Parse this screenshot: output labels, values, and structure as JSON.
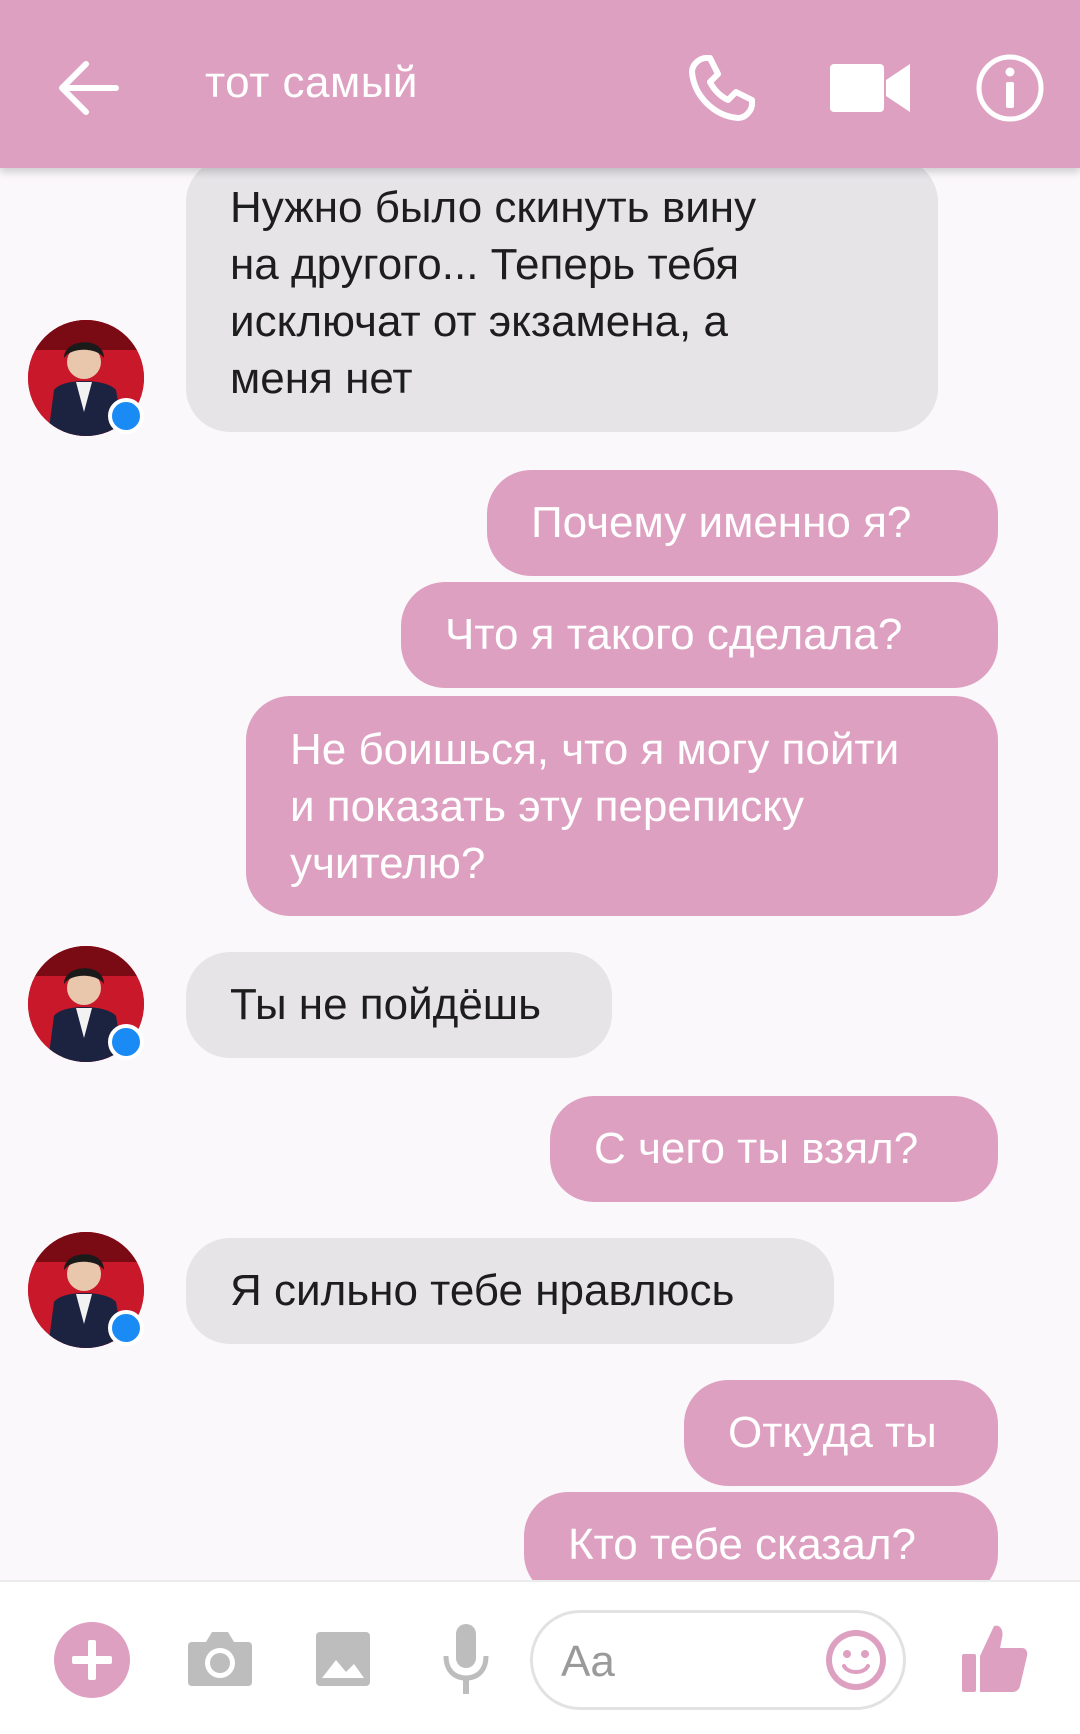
{
  "header": {
    "title": "тот самый",
    "back_icon": "arrow-left-icon",
    "call_icon": "phone-icon",
    "video_icon": "video-camera-icon",
    "info_icon": "info-icon",
    "background_color": "#dea0c1"
  },
  "messages": [
    {
      "from": "contact",
      "text": "Нужно было скинуть вину\nна другого...  Теперь тебя\nисключат от экзамена, а\nменя нет"
    },
    {
      "from": "me",
      "text": "Почему именно я?"
    },
    {
      "from": "me",
      "text": "Что я такого сделала?"
    },
    {
      "from": "me",
      "text": "Не боишься, что я могу пойти\nи показать эту переписку\nучителю?"
    },
    {
      "from": "contact",
      "text": "Ты не пойдёшь"
    },
    {
      "from": "me",
      "text": "С чего ты взял?"
    },
    {
      "from": "contact",
      "text": "Я сильно тебе нравлюсь"
    },
    {
      "from": "me",
      "text": "Откуда ты"
    },
    {
      "from": "me",
      "text": "Кто тебе сказал?"
    }
  ],
  "colors": {
    "outgoing_bubble": "#dea0c1",
    "incoming_bubble": "#e6e4e7",
    "messenger_badge": "#1a8bf5"
  },
  "composer": {
    "placeholder": "Aa",
    "icons": [
      "plus-icon",
      "camera-icon",
      "image-icon",
      "microphone-icon",
      "smiley-icon",
      "thumbs-up-icon"
    ]
  }
}
